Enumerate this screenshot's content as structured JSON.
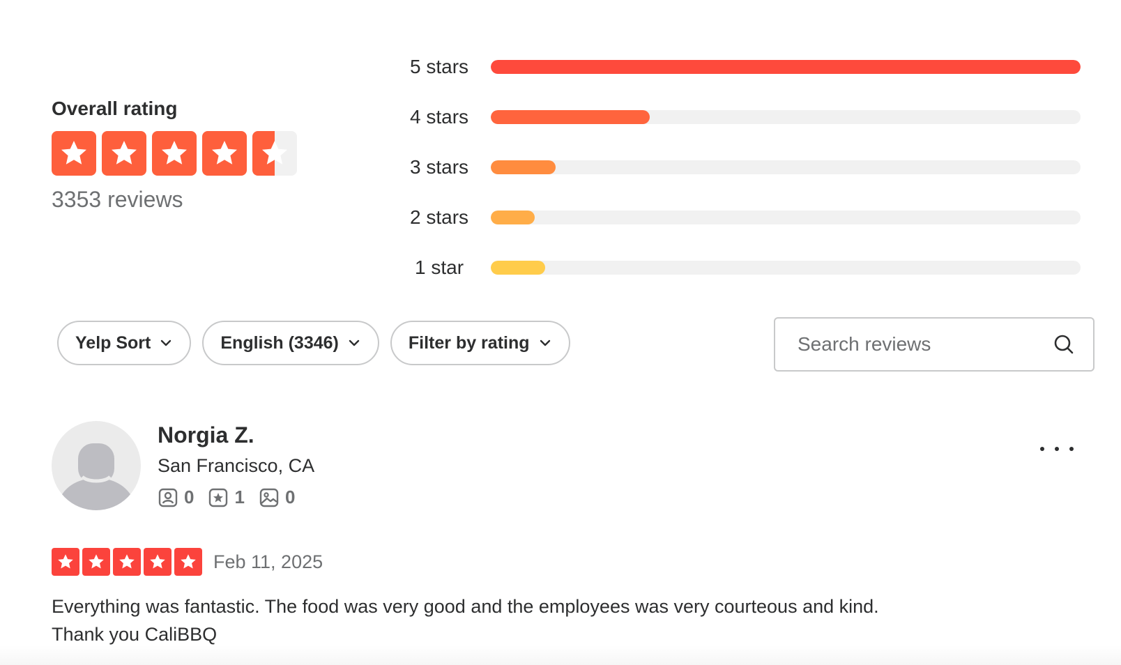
{
  "overall": {
    "title": "Overall rating",
    "rating": 4.5,
    "review_count_label": "3353 reviews",
    "star_color": "#fe5f3c"
  },
  "distribution": [
    {
      "label": "5 stars",
      "fraction": 1.0,
      "color": "#fe4a3c"
    },
    {
      "label": "4 stars",
      "fraction": 0.27,
      "color": "#ff643d"
    },
    {
      "label": "3 stars",
      "fraction": 0.11,
      "color": "#ff8c3f"
    },
    {
      "label": "2 stars",
      "fraction": 0.075,
      "color": "#ffad48"
    },
    {
      "label": "1 star",
      "fraction": 0.092,
      "color": "#ffcc4b"
    }
  ],
  "filters": {
    "sort_label": "Yelp Sort",
    "language_label": "English (3346)",
    "rating_filter_label": "Filter by rating",
    "search_placeholder": "Search reviews"
  },
  "review": {
    "user_name": "Norgia Z.",
    "user_location": "San Francisco, CA",
    "friends_count": "0",
    "reviews_count": "1",
    "photos_count": "0",
    "rating": 5,
    "star_color": "#fb433c",
    "date": "Feb 11, 2025",
    "text": "Everything was fantastic. The food was very good and the employees was very courteous and kind.\nThank you CaliBBQ"
  },
  "icons": {
    "star": "star-icon",
    "chevron": "chevron-down-icon",
    "search": "search-icon",
    "friends": "friends-icon",
    "reviews": "review-star-icon",
    "photos": "photo-icon",
    "more": "more-dots-icon"
  }
}
